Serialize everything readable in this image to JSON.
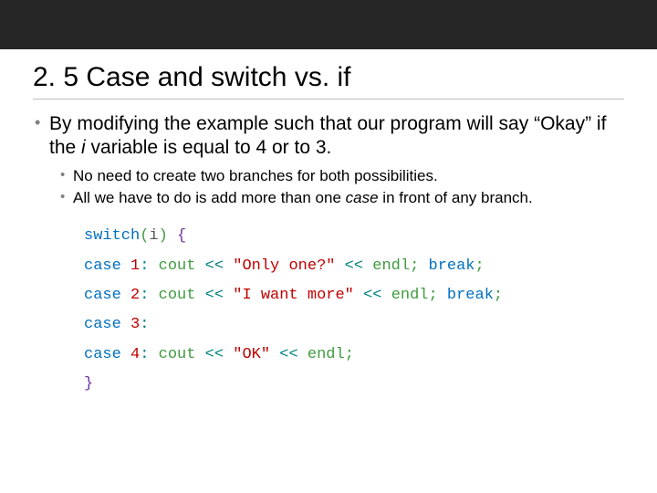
{
  "title": "2. 5 Case and switch vs. if",
  "bullets": [
    {
      "pre": "By modifying the example such that our program will say “Okay” if the ",
      "em": "i",
      "post": " variable is equal to 4 or to 3."
    }
  ],
  "subbullets": [
    "No need to create two branches for both possibilities.",
    {
      "pre": "All we have to do is add more than one ",
      "em": "case",
      "post": " in front of any branch."
    }
  ],
  "code": [
    [
      {
        "t": "switch",
        "c": "tok-kw"
      },
      {
        "t": "(",
        "c": "tok-paren"
      },
      {
        "t": "i",
        "c": "tok-id"
      },
      {
        "t": ")",
        "c": "tok-paren"
      },
      {
        "t": " ",
        "c": ""
      },
      {
        "t": "{",
        "c": "tok-brace"
      }
    ],
    [
      {
        "t": "case",
        "c": "tok-kw"
      },
      {
        "t": " ",
        "c": ""
      },
      {
        "t": "1",
        "c": "tok-num"
      },
      {
        "t": ":",
        "c": "tok-op"
      },
      {
        "t": " ",
        "c": ""
      },
      {
        "t": "cout",
        "c": "tok-obj"
      },
      {
        "t": " ",
        "c": ""
      },
      {
        "t": "<<",
        "c": "tok-op"
      },
      {
        "t": " ",
        "c": ""
      },
      {
        "t": "\"Only one?\"",
        "c": "tok-str"
      },
      {
        "t": " ",
        "c": ""
      },
      {
        "t": "<<",
        "c": "tok-op"
      },
      {
        "t": " ",
        "c": ""
      },
      {
        "t": "endl",
        "c": "tok-obj"
      },
      {
        "t": ";",
        "c": "tok-semi"
      },
      {
        "t": " ",
        "c": ""
      },
      {
        "t": "break",
        "c": "tok-kw"
      },
      {
        "t": ";",
        "c": "tok-semi"
      }
    ],
    [
      {
        "t": "case",
        "c": "tok-kw"
      },
      {
        "t": " ",
        "c": ""
      },
      {
        "t": "2",
        "c": "tok-num"
      },
      {
        "t": ":",
        "c": "tok-op"
      },
      {
        "t": " ",
        "c": ""
      },
      {
        "t": "cout",
        "c": "tok-obj"
      },
      {
        "t": " ",
        "c": ""
      },
      {
        "t": "<<",
        "c": "tok-op"
      },
      {
        "t": " ",
        "c": ""
      },
      {
        "t": "\"I want more\"",
        "c": "tok-str"
      },
      {
        "t": " ",
        "c": ""
      },
      {
        "t": "<<",
        "c": "tok-op"
      },
      {
        "t": " ",
        "c": ""
      },
      {
        "t": "endl",
        "c": "tok-obj"
      },
      {
        "t": ";",
        "c": "tok-semi"
      },
      {
        "t": " ",
        "c": ""
      },
      {
        "t": "break",
        "c": "tok-kw"
      },
      {
        "t": ";",
        "c": "tok-semi"
      }
    ],
    [
      {
        "t": "case",
        "c": "tok-kw"
      },
      {
        "t": " ",
        "c": ""
      },
      {
        "t": "3",
        "c": "tok-num"
      },
      {
        "t": ":",
        "c": "tok-op"
      }
    ],
    [
      {
        "t": "case",
        "c": "tok-kw"
      },
      {
        "t": " ",
        "c": ""
      },
      {
        "t": "4",
        "c": "tok-num"
      },
      {
        "t": ":",
        "c": "tok-op"
      },
      {
        "t": " ",
        "c": ""
      },
      {
        "t": "cout",
        "c": "tok-obj"
      },
      {
        "t": " ",
        "c": ""
      },
      {
        "t": "<<",
        "c": "tok-op"
      },
      {
        "t": " ",
        "c": ""
      },
      {
        "t": "\"OK\"",
        "c": "tok-str"
      },
      {
        "t": " ",
        "c": ""
      },
      {
        "t": "<<",
        "c": "tok-op"
      },
      {
        "t": " ",
        "c": ""
      },
      {
        "t": "endl",
        "c": "tok-obj"
      },
      {
        "t": ";",
        "c": "tok-semi"
      }
    ],
    [
      {
        "t": "}",
        "c": "tok-brace"
      }
    ]
  ]
}
